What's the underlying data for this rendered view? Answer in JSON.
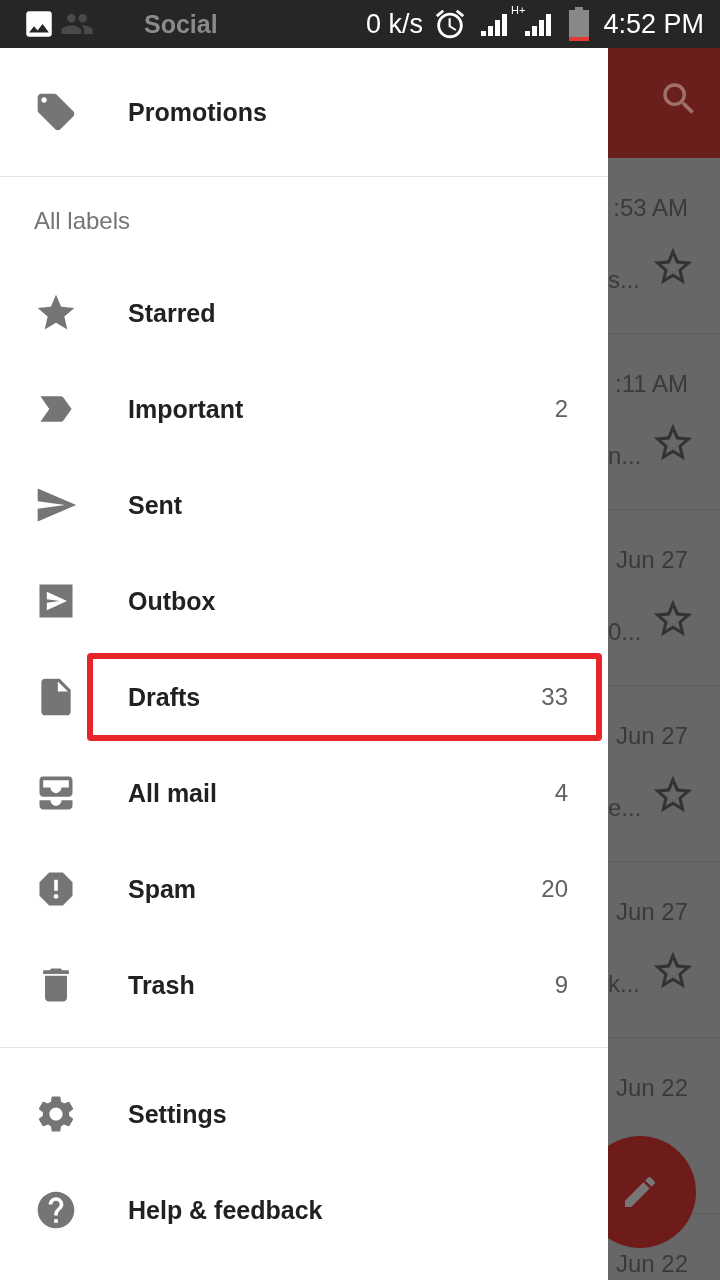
{
  "status_bar": {
    "speed": "0 k/s",
    "network": "H+",
    "time": "4:52 PM"
  },
  "drawer": {
    "top_items": [
      {
        "label": "Social"
      },
      {
        "label": "Promotions"
      }
    ],
    "section_title": "All labels",
    "labels": [
      {
        "label": "Starred",
        "highlighted": false
      },
      {
        "label": "Important",
        "count": "2",
        "highlighted": false
      },
      {
        "label": "Sent",
        "highlighted": false
      },
      {
        "label": "Outbox",
        "highlighted": false
      },
      {
        "label": "Drafts",
        "count": "33",
        "highlighted": true
      },
      {
        "label": "All mail",
        "count": "4",
        "highlighted": false
      },
      {
        "label": "Spam",
        "count": "20",
        "highlighted": false
      },
      {
        "label": "Trash",
        "count": "9",
        "highlighted": false
      }
    ],
    "bottom_items": [
      {
        "label": "Settings"
      },
      {
        "label": "Help & feedback"
      }
    ]
  },
  "mail_list": {
    "rows": [
      {
        "time": ":53 AM",
        "snippet": "s..."
      },
      {
        "time": ":11 AM",
        "snippet": "n..."
      },
      {
        "time": "Jun 27",
        "snippet": "0..."
      },
      {
        "time": "Jun 27",
        "snippet": "e..."
      },
      {
        "time": "Jun 27",
        "snippet": "k..."
      },
      {
        "time": "Jun 22"
      },
      {
        "time": "Jun 22"
      }
    ]
  }
}
